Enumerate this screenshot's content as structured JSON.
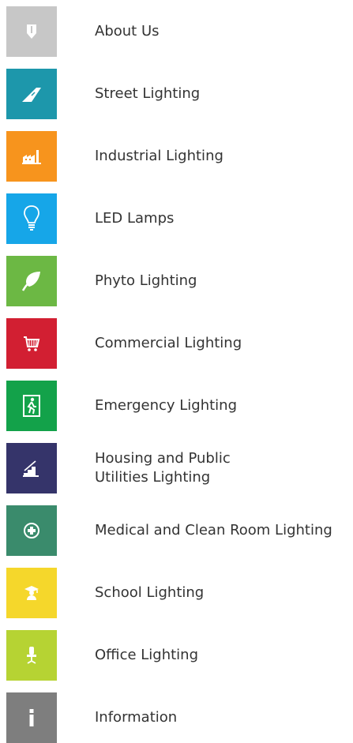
{
  "menu": {
    "items": [
      {
        "id": "about",
        "label": "About Us",
        "icon": "shield-icon",
        "color": "#c7c7c7"
      },
      {
        "id": "street",
        "label": "Street Lighting",
        "icon": "road-icon",
        "color": "#1d97ab"
      },
      {
        "id": "industrial",
        "label": "Industrial Lighting",
        "icon": "factory-icon",
        "color": "#f7941d"
      },
      {
        "id": "led",
        "label": "LED Lamps",
        "icon": "lightbulb-icon",
        "color": "#16a6e8"
      },
      {
        "id": "phyto",
        "label": "Phyto Lighting",
        "icon": "leaf-icon",
        "color": "#6cb844"
      },
      {
        "id": "commercial",
        "label": "Commercial Lighting",
        "icon": "shopping-cart-icon",
        "color": "#d21f32"
      },
      {
        "id": "emergency",
        "label": "Emergency Lighting",
        "icon": "emergency-exit-icon",
        "color": "#13a24a"
      },
      {
        "id": "housing",
        "label_line1": "Housing and Public",
        "label_line2": "Utilities Lighting",
        "icon": "stairs-icon",
        "color": "#35346a"
      },
      {
        "id": "medical",
        "label": "Medical and Clean Room Lighting",
        "icon": "medical-cross-icon",
        "color": "#3a8b6c"
      },
      {
        "id": "school",
        "label": "School Lighting",
        "icon": "graduate-icon",
        "color": "#f5d72b"
      },
      {
        "id": "office",
        "label": "Office Lighting",
        "icon": "office-chair-icon",
        "color": "#b6d333"
      },
      {
        "id": "information",
        "label": "Information",
        "icon": "info-icon",
        "color": "#7e7e7e"
      }
    ]
  }
}
